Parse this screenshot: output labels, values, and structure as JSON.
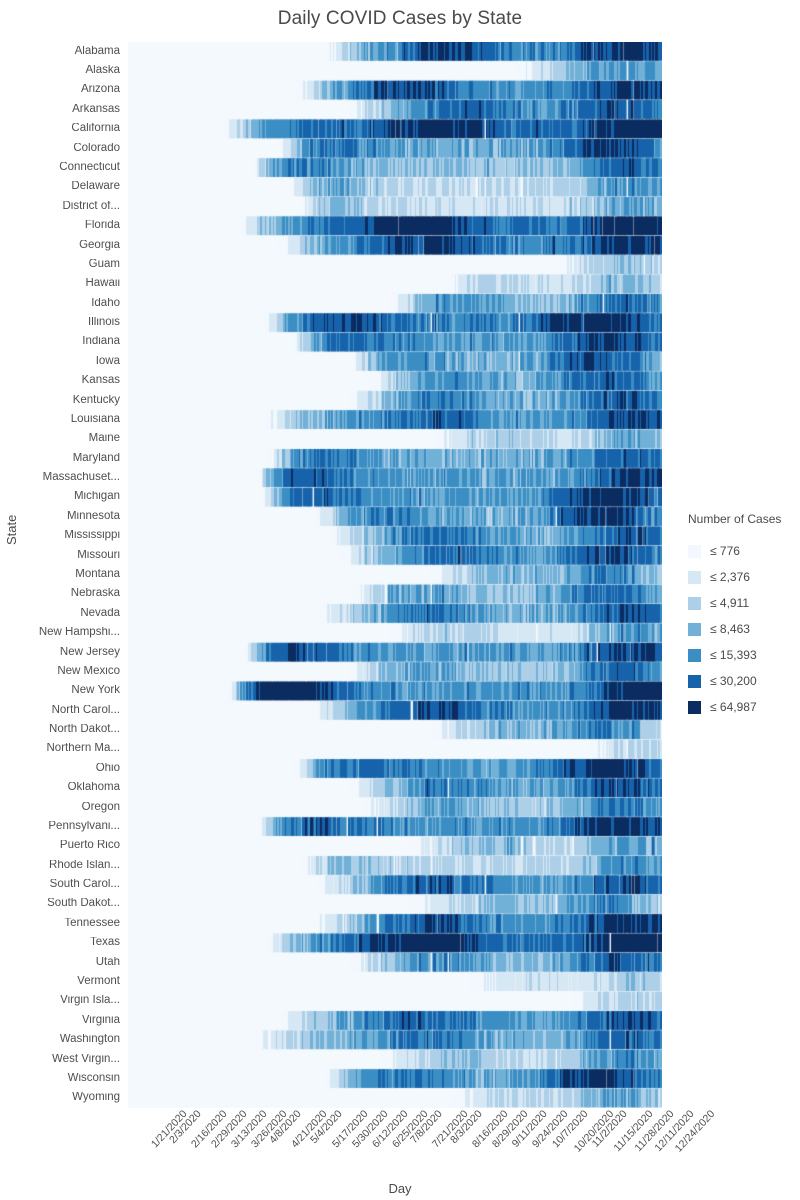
{
  "chart_data": {
    "type": "heatmap",
    "title": "Daily COVID Cases by State",
    "xlabel": "Day",
    "ylabel": "State",
    "legend_title": "Number of Cases",
    "legend_position": "right",
    "grid": false,
    "x_tick_labels": [
      "1/21/2020",
      "2/3/2020",
      "2/16/2020",
      "2/29/2020",
      "3/13/2020",
      "3/26/2020",
      "4/8/2020",
      "4/21/2020",
      "5/4/2020",
      "5/17/2020",
      "5/30/2020",
      "6/12/2020",
      "6/25/2020",
      "7/8/2020",
      "7/21/2020",
      "8/3/2020",
      "8/16/2020",
      "8/29/2020",
      "9/11/2020",
      "9/24/2020",
      "10/7/2020",
      "10/20/2020",
      "11/2/2020",
      "11/15/2020",
      "11/28/2020",
      "12/11/2020",
      "12/24/2020"
    ],
    "x_domain_start": "1/21/2020",
    "x_domain_end": "12/31/2020",
    "x_tick_interval_days": 13,
    "x_total_days": 346,
    "categories": [
      "Alabama",
      "Alaska",
      "Arizona",
      "Arkansas",
      "California",
      "Colorado",
      "Connecticut",
      "Delaware",
      "District of...",
      "Florida",
      "Georgia",
      "Guam",
      "Hawaii",
      "Idaho",
      "Illinois",
      "Indiana",
      "Iowa",
      "Kansas",
      "Kentucky",
      "Louisiana",
      "Maine",
      "Maryland",
      "Massachuset...",
      "Michigan",
      "Minnesota",
      "Mississippi",
      "Missouri",
      "Montana",
      "Nebraska",
      "Nevada",
      "New Hampshi...",
      "New Jersey",
      "New Mexico",
      "New York",
      "North Carol...",
      "North Dakot...",
      "Northern Ma...",
      "Ohio",
      "Oklahoma",
      "Oregon",
      "Pennsylvani...",
      "Puerto Rico",
      "Rhode Islan...",
      "South Carol...",
      "South Dakot...",
      "Tennessee",
      "Texas",
      "Utah",
      "Vermont",
      "Virgin Isla...",
      "Virginia",
      "Washington",
      "West Virgin...",
      "Wisconsin",
      "Wyoming"
    ],
    "color_bins": [
      {
        "label": "≤ 776",
        "max": 776,
        "color": "#f2f8fd"
      },
      {
        "label": "≤ 2,376",
        "max": 2376,
        "color": "#d7e8f5"
      },
      {
        "label": "≤ 4,911",
        "max": 4911,
        "color": "#adcfe7"
      },
      {
        "label": "≤ 8,463",
        "max": 8463,
        "color": "#71b0d7"
      },
      {
        "label": "≤ 15,393",
        "max": 15393,
        "color": "#3b8ec4"
      },
      {
        "label": "≤ 30,200",
        "max": 30200,
        "color": "#1763ab"
      },
      {
        "label": "≤ 64,987",
        "max": 64987,
        "color": "#0b2c60"
      }
    ],
    "plot_background": "#f4f9fd",
    "series": [
      {
        "name": "Alabama",
        "onset": 0.36,
        "peak1": 0.6,
        "peak1_lvl": 0.3,
        "peak2": 0.93,
        "peak2_lvl": 0.42,
        "base": 0.18,
        "noise": 0.55
      },
      {
        "name": "Alaska",
        "onset": 0.7,
        "peak1": 0.88,
        "peak1_lvl": 0.07,
        "peak2": 0.97,
        "peak2_lvl": 0.1,
        "base": 0.03,
        "noise": 0.4
      },
      {
        "name": "Arizona",
        "onset": 0.3,
        "peak1": 0.52,
        "peak1_lvl": 0.36,
        "peak2": 0.95,
        "peak2_lvl": 0.52,
        "base": 0.16,
        "noise": 0.6
      },
      {
        "name": "Arkansas",
        "onset": 0.4,
        "peak1": 0.64,
        "peak1_lvl": 0.22,
        "peak2": 0.92,
        "peak2_lvl": 0.3,
        "base": 0.12,
        "noise": 0.55
      },
      {
        "name": "California",
        "onset": 0.17,
        "peak1": 0.58,
        "peak1_lvl": 0.55,
        "peak2": 0.98,
        "peak2_lvl": 1.0,
        "base": 0.26,
        "noise": 0.45
      },
      {
        "name": "Colorado",
        "onset": 0.28,
        "peak1": 0.38,
        "peak1_lvl": 0.18,
        "peak2": 0.9,
        "peak2_lvl": 0.4,
        "base": 0.11,
        "noise": 0.5
      },
      {
        "name": "Connecticut",
        "onset": 0.23,
        "peak1": 0.32,
        "peak1_lvl": 0.17,
        "peak2": 0.94,
        "peak2_lvl": 0.26,
        "base": 0.07,
        "noise": 0.55
      },
      {
        "name": "Delaware",
        "onset": 0.3,
        "peak1": 0.36,
        "peak1_lvl": 0.09,
        "peak2": 0.95,
        "peak2_lvl": 0.13,
        "base": 0.04,
        "noise": 0.5
      },
      {
        "name": "District of...",
        "onset": 0.32,
        "peak1": 0.38,
        "peak1_lvl": 0.07,
        "peak2": 0.95,
        "peak2_lvl": 0.09,
        "base": 0.03,
        "noise": 0.45
      },
      {
        "name": "Florida",
        "onset": 0.2,
        "peak1": 0.55,
        "peak1_lvl": 0.56,
        "peak2": 0.95,
        "peak2_lvl": 0.6,
        "base": 0.24,
        "noise": 0.5
      },
      {
        "name": "Georgia",
        "onset": 0.27,
        "peak1": 0.57,
        "peak1_lvl": 0.4,
        "peak2": 0.95,
        "peak2_lvl": 0.48,
        "base": 0.19,
        "noise": 0.55
      },
      {
        "name": "Guam",
        "onset": 0.8,
        "peak1": 0.88,
        "peak1_lvl": 0.03,
        "peak2": 0.96,
        "peak2_lvl": 0.04,
        "base": 0.01,
        "noise": 0.35
      },
      {
        "name": "Hawaii",
        "onset": 0.6,
        "peak1": 0.66,
        "peak1_lvl": 0.05,
        "peak2": 0.93,
        "peak2_lvl": 0.06,
        "base": 0.02,
        "noise": 0.4
      },
      {
        "name": "Idaho",
        "onset": 0.48,
        "peak1": 0.62,
        "peak1_lvl": 0.1,
        "peak2": 0.93,
        "peak2_lvl": 0.22,
        "base": 0.06,
        "noise": 0.5
      },
      {
        "name": "Illinois",
        "onset": 0.25,
        "peak1": 0.4,
        "peak1_lvl": 0.3,
        "peak2": 0.88,
        "peak2_lvl": 0.62,
        "base": 0.2,
        "noise": 0.5
      },
      {
        "name": "Indiana",
        "onset": 0.3,
        "peak1": 0.42,
        "peak1_lvl": 0.18,
        "peak2": 0.9,
        "peak2_lvl": 0.46,
        "base": 0.14,
        "noise": 0.5
      },
      {
        "name": "Iowa",
        "onset": 0.42,
        "peak1": 0.5,
        "peak1_lvl": 0.12,
        "peak2": 0.88,
        "peak2_lvl": 0.35,
        "base": 0.09,
        "noise": 0.55
      },
      {
        "name": "Kansas",
        "onset": 0.44,
        "peak1": 0.6,
        "peak1_lvl": 0.11,
        "peak2": 0.9,
        "peak2_lvl": 0.28,
        "base": 0.08,
        "noise": 0.6
      },
      {
        "name": "Kentucky",
        "onset": 0.4,
        "peak1": 0.58,
        "peak1_lvl": 0.13,
        "peak2": 0.93,
        "peak2_lvl": 0.3,
        "base": 0.09,
        "noise": 0.55
      },
      {
        "name": "Louisiana",
        "onset": 0.24,
        "peak1": 0.58,
        "peak1_lvl": 0.26,
        "peak2": 0.95,
        "peak2_lvl": 0.34,
        "base": 0.13,
        "noise": 0.55
      },
      {
        "name": "Maine",
        "onset": 0.55,
        "peak1": 0.7,
        "peak1_lvl": 0.04,
        "peak2": 0.95,
        "peak2_lvl": 0.09,
        "base": 0.02,
        "noise": 0.45
      },
      {
        "name": "Maryland",
        "onset": 0.26,
        "peak1": 0.36,
        "peak1_lvl": 0.18,
        "peak2": 0.94,
        "peak2_lvl": 0.27,
        "base": 0.1,
        "noise": 0.5
      },
      {
        "name": "Massachuset...",
        "onset": 0.24,
        "peak1": 0.33,
        "peak1_lvl": 0.28,
        "peak2": 0.95,
        "peak2_lvl": 0.38,
        "base": 0.12,
        "noise": 0.5
      },
      {
        "name": "Michigan",
        "onset": 0.25,
        "peak1": 0.34,
        "peak1_lvl": 0.26,
        "peak2": 0.9,
        "peak2_lvl": 0.58,
        "base": 0.14,
        "noise": 0.5
      },
      {
        "name": "Minnesota",
        "onset": 0.34,
        "peak1": 0.48,
        "peak1_lvl": 0.14,
        "peak2": 0.89,
        "peak2_lvl": 0.46,
        "base": 0.1,
        "noise": 0.5
      },
      {
        "name": "Mississippi",
        "onset": 0.36,
        "peak1": 0.58,
        "peak1_lvl": 0.17,
        "peak2": 0.94,
        "peak2_lvl": 0.28,
        "base": 0.1,
        "noise": 0.55
      },
      {
        "name": "Missouri",
        "onset": 0.38,
        "peak1": 0.6,
        "peak1_lvl": 0.16,
        "peak2": 0.9,
        "peak2_lvl": 0.38,
        "base": 0.11,
        "noise": 0.55
      },
      {
        "name": "Montana",
        "onset": 0.55,
        "peak1": 0.7,
        "peak1_lvl": 0.06,
        "peak2": 0.9,
        "peak2_lvl": 0.16,
        "base": 0.04,
        "noise": 0.5
      },
      {
        "name": "Nebraska",
        "onset": 0.42,
        "peak1": 0.52,
        "peak1_lvl": 0.09,
        "peak2": 0.9,
        "peak2_lvl": 0.24,
        "base": 0.07,
        "noise": 0.55
      },
      {
        "name": "Nevada",
        "onset": 0.34,
        "peak1": 0.56,
        "peak1_lvl": 0.16,
        "peak2": 0.94,
        "peak2_lvl": 0.3,
        "base": 0.1,
        "noise": 0.55
      },
      {
        "name": "New Hampshi...",
        "onset": 0.48,
        "peak1": 0.6,
        "peak1_lvl": 0.04,
        "peak2": 0.95,
        "peak2_lvl": 0.12,
        "base": 0.02,
        "noise": 0.45
      },
      {
        "name": "New Jersey",
        "onset": 0.22,
        "peak1": 0.31,
        "peak1_lvl": 0.32,
        "peak2": 0.95,
        "peak2_lvl": 0.44,
        "base": 0.13,
        "noise": 0.5
      },
      {
        "name": "New Mexico",
        "onset": 0.4,
        "peak1": 0.55,
        "peak1_lvl": 0.08,
        "peak2": 0.92,
        "peak2_lvl": 0.22,
        "base": 0.06,
        "noise": 0.5
      },
      {
        "name": "New York",
        "onset": 0.19,
        "peak1": 0.3,
        "peak1_lvl": 0.72,
        "peak2": 0.97,
        "peak2_lvl": 0.6,
        "base": 0.16,
        "noise": 0.45
      },
      {
        "name": "North Carol...",
        "onset": 0.33,
        "peak1": 0.58,
        "peak1_lvl": 0.26,
        "peak2": 0.94,
        "peak2_lvl": 0.42,
        "base": 0.16,
        "noise": 0.55
      },
      {
        "name": "North Dakot...",
        "onset": 0.55,
        "peak1": 0.72,
        "peak1_lvl": 0.06,
        "peak2": 0.89,
        "peak2_lvl": 0.17,
        "base": 0.04,
        "noise": 0.5
      },
      {
        "name": "Northern Ma...",
        "onset": 0.86,
        "peak1": 0.92,
        "peak1_lvl": 0.02,
        "peak2": 0.97,
        "peak2_lvl": 0.02,
        "base": 0.01,
        "noise": 0.3
      },
      {
        "name": "Ohio",
        "onset": 0.3,
        "peak1": 0.44,
        "peak1_lvl": 0.2,
        "peak2": 0.9,
        "peak2_lvl": 0.58,
        "base": 0.15,
        "noise": 0.5
      },
      {
        "name": "Oklahoma",
        "onset": 0.4,
        "peak1": 0.6,
        "peak1_lvl": 0.14,
        "peak2": 0.92,
        "peak2_lvl": 0.34,
        "base": 0.1,
        "noise": 0.55
      },
      {
        "name": "Oregon",
        "onset": 0.42,
        "peak1": 0.6,
        "peak1_lvl": 0.07,
        "peak2": 0.93,
        "peak2_lvl": 0.18,
        "base": 0.05,
        "noise": 0.5
      },
      {
        "name": "Pennsylvani...",
        "onset": 0.24,
        "peak1": 0.35,
        "peak1_lvl": 0.26,
        "peak2": 0.92,
        "peak2_lvl": 0.62,
        "base": 0.16,
        "noise": 0.5
      },
      {
        "name": "Puerto Rico",
        "onset": 0.5,
        "peak1": 0.68,
        "peak1_lvl": 0.05,
        "peak2": 0.94,
        "peak2_lvl": 0.11,
        "base": 0.03,
        "noise": 0.45
      },
      {
        "name": "Rhode Islan...",
        "onset": 0.32,
        "peak1": 0.4,
        "peak1_lvl": 0.06,
        "peak2": 0.95,
        "peak2_lvl": 0.16,
        "base": 0.04,
        "noise": 0.5
      },
      {
        "name": "South Carol...",
        "onset": 0.34,
        "peak1": 0.58,
        "peak1_lvl": 0.25,
        "peak2": 0.94,
        "peak2_lvl": 0.33,
        "base": 0.13,
        "noise": 0.55
      },
      {
        "name": "South Dakot...",
        "onset": 0.5,
        "peak1": 0.7,
        "peak1_lvl": 0.05,
        "peak2": 0.89,
        "peak2_lvl": 0.15,
        "base": 0.03,
        "noise": 0.5
      },
      {
        "name": "Tennessee",
        "onset": 0.34,
        "peak1": 0.58,
        "peak1_lvl": 0.25,
        "peak2": 0.94,
        "peak2_lvl": 0.5,
        "base": 0.15,
        "noise": 0.55
      },
      {
        "name": "Texas",
        "onset": 0.25,
        "peak1": 0.56,
        "peak1_lvl": 0.62,
        "peak2": 0.97,
        "peak2_lvl": 0.82,
        "base": 0.26,
        "noise": 0.5
      },
      {
        "name": "Utah",
        "onset": 0.4,
        "peak1": 0.58,
        "peak1_lvl": 0.11,
        "peak2": 0.92,
        "peak2_lvl": 0.28,
        "base": 0.08,
        "noise": 0.55
      },
      {
        "name": "Vermont",
        "onset": 0.6,
        "peak1": 0.76,
        "peak1_lvl": 0.02,
        "peak2": 0.96,
        "peak2_lvl": 0.05,
        "base": 0.01,
        "noise": 0.4
      },
      {
        "name": "Virgin Isla...",
        "onset": 0.82,
        "peak1": 0.9,
        "peak1_lvl": 0.02,
        "peak2": 0.97,
        "peak2_lvl": 0.03,
        "base": 0.01,
        "noise": 0.3
      },
      {
        "name": "Virginia",
        "onset": 0.27,
        "peak1": 0.55,
        "peak1_lvl": 0.24,
        "peak2": 0.94,
        "peak2_lvl": 0.34,
        "base": 0.13,
        "noise": 0.5
      },
      {
        "name": "Washington",
        "onset": 0.22,
        "peak1": 0.56,
        "peak1_lvl": 0.16,
        "peak2": 0.94,
        "peak2_lvl": 0.3,
        "base": 0.09,
        "noise": 0.5
      },
      {
        "name": "West Virgin...",
        "onset": 0.45,
        "peak1": 0.62,
        "peak1_lvl": 0.05,
        "peak2": 0.93,
        "peak2_lvl": 0.16,
        "base": 0.03,
        "noise": 0.5
      },
      {
        "name": "Wisconsin",
        "onset": 0.36,
        "peak1": 0.5,
        "peak1_lvl": 0.16,
        "peak2": 0.88,
        "peak2_lvl": 0.52,
        "base": 0.12,
        "noise": 0.5
      },
      {
        "name": "Wyoming",
        "onset": 0.58,
        "peak1": 0.74,
        "peak1_lvl": 0.03,
        "peak2": 0.92,
        "peak2_lvl": 0.1,
        "base": 0.02,
        "noise": 0.45
      }
    ]
  }
}
